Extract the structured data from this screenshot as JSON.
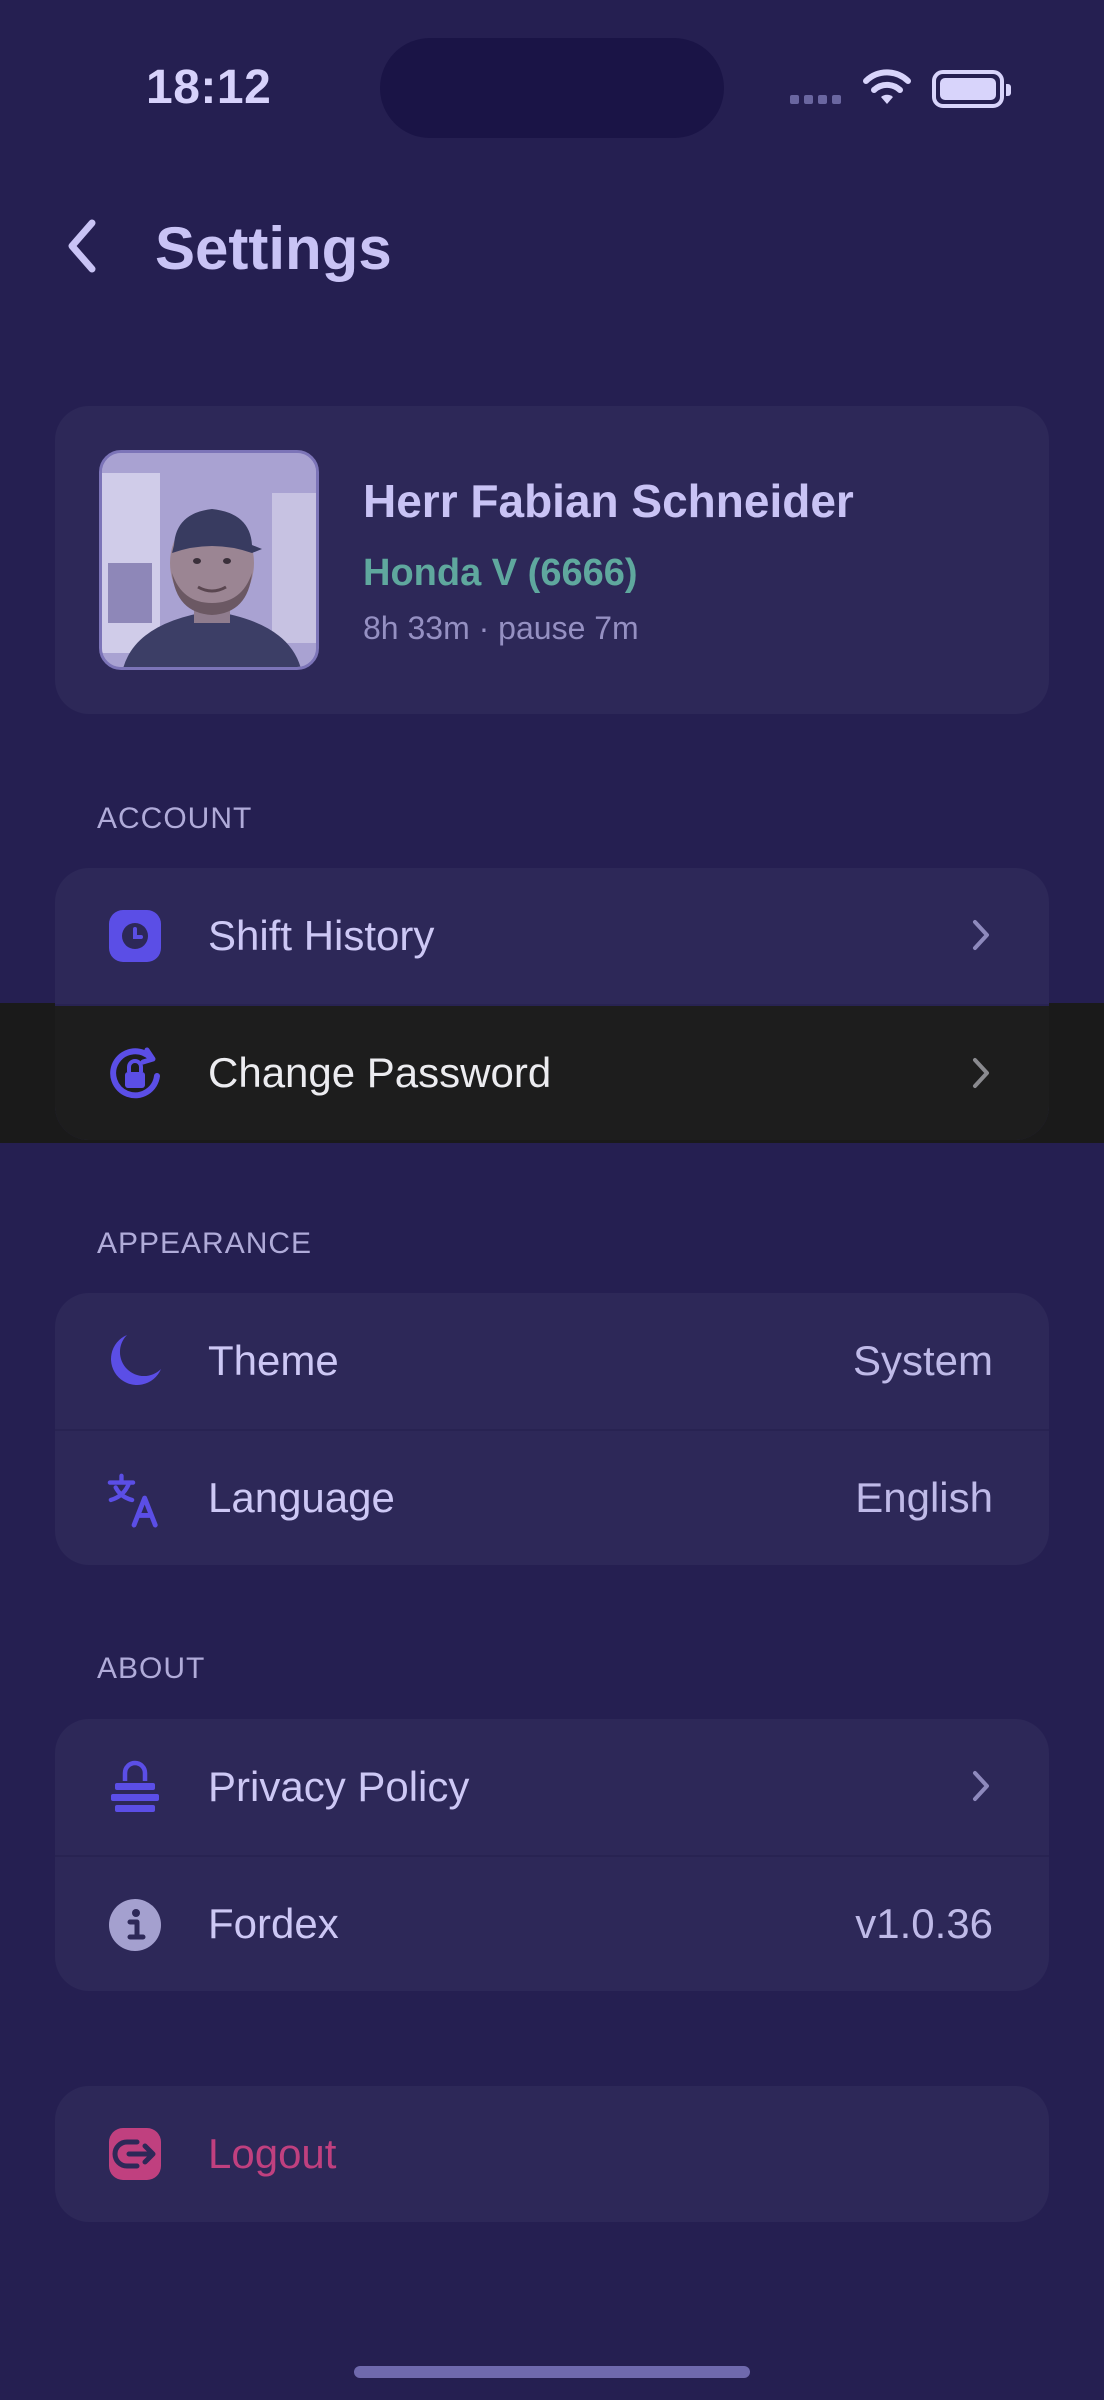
{
  "status_bar": {
    "time": "18:12"
  },
  "header": {
    "title": "Settings"
  },
  "profile": {
    "name": "Herr Fabian Schneider",
    "vehicle": "Honda V (6666)",
    "shift_time": "8h 33m · pause 7m"
  },
  "sections": {
    "account": {
      "label": "ACCOUNT",
      "items": [
        {
          "label": "Shift History",
          "icon": "clock-icon"
        },
        {
          "label": "Change Password",
          "icon": "lock-reset-icon"
        }
      ]
    },
    "appearance": {
      "label": "APPEARANCE",
      "items": [
        {
          "label": "Theme",
          "value": "System",
          "icon": "moon-icon"
        },
        {
          "label": "Language",
          "value": "English",
          "icon": "translate-icon"
        }
      ]
    },
    "about": {
      "label": "ABOUT",
      "items": [
        {
          "label": "Privacy Policy",
          "icon": "privacy-icon"
        },
        {
          "label": "Fordex",
          "value": "v1.0.36",
          "icon": "info-icon"
        }
      ]
    }
  },
  "logout": {
    "label": "Logout",
    "icon": "logout-icon"
  },
  "colors": {
    "background": "#251f51",
    "card": "#2d2858",
    "accent": "#5b4ee6",
    "vehicle": "#5fa89e",
    "logout": "#c0407f"
  }
}
